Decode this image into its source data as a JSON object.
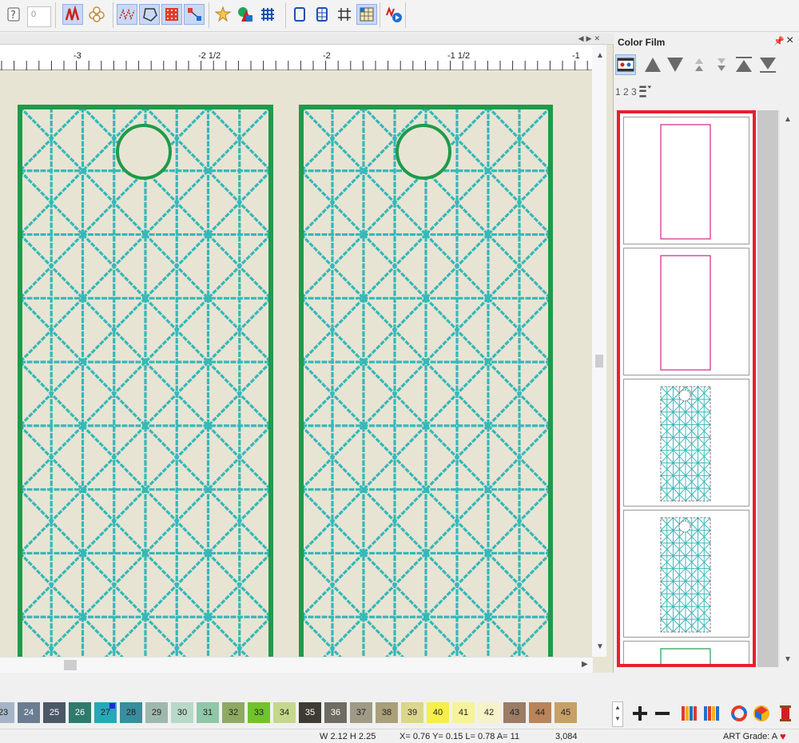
{
  "toolbar": {
    "zero_field_value": "0"
  },
  "ruler": {
    "labels": [
      {
        "text": "-3"
      },
      {
        "text": "-2 1/2"
      },
      {
        "text": "-2"
      },
      {
        "text": "-1 1/2"
      },
      {
        "text": "-1"
      }
    ]
  },
  "color_film": {
    "title": "Color Film",
    "sequence_label": "1 2 3"
  },
  "palette": {
    "swatches": [
      {
        "number": "23",
        "color": "#a6b5c6"
      },
      {
        "number": "24",
        "color": "#6a7d91"
      },
      {
        "number": "25",
        "color": "#4b5866"
      },
      {
        "number": "26",
        "color": "#2f7a6c"
      },
      {
        "number": "27",
        "color": "#27a8b8"
      },
      {
        "number": "28",
        "color": "#3a8d9c"
      },
      {
        "number": "29",
        "color": "#9fb8ac"
      },
      {
        "number": "30",
        "color": "#b8d8c8"
      },
      {
        "number": "31",
        "color": "#8fc7a8"
      },
      {
        "number": "32",
        "color": "#8eaa62"
      },
      {
        "number": "33",
        "color": "#72c22a"
      },
      {
        "number": "34",
        "color": "#c5d88a"
      },
      {
        "number": "35",
        "color": "#3e3b33"
      },
      {
        "number": "36",
        "color": "#6f6c62"
      },
      {
        "number": "37",
        "color": "#9f9a86"
      },
      {
        "number": "38",
        "color": "#a9a07a"
      },
      {
        "number": "39",
        "color": "#dcd68a"
      },
      {
        "number": "40",
        "color": "#f6ee4a"
      },
      {
        "number": "41",
        "color": "#f6f39a"
      },
      {
        "number": "42",
        "color": "#f6f3c8"
      },
      {
        "number": "43",
        "color": "#9c7c64"
      },
      {
        "number": "44",
        "color": "#b9845a"
      },
      {
        "number": "45",
        "color": "#c7a068"
      }
    ],
    "selected_number": "27"
  },
  "status": {
    "size": "W 2.12 H 2.25",
    "coords": "X= 0.76 Y= 0.15 L= 0.78 A=  11",
    "stitches": "3,084",
    "art_grade": "ART Grade: A"
  },
  "colors": {
    "canvas_bg": "#e8e4d4",
    "border_green": "#1e9b4a",
    "grid_teal": "#35b8b8",
    "film_highlight": "#e8202a",
    "film_outline": "#d6218a"
  }
}
